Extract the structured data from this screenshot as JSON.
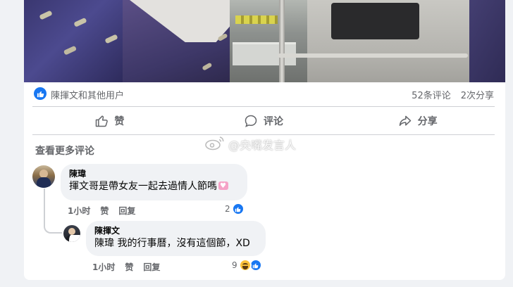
{
  "post": {
    "reactors_text": "陳揮文和其他用户",
    "comment_count": "52条评论",
    "share_count": "2次分享"
  },
  "actions": {
    "like_label": "赞",
    "comment_label": "评论",
    "share_label": "分享"
  },
  "more_comments_label": "查看更多评论",
  "watermark_text": "@央嘴发言人",
  "comments": [
    {
      "author": "陳瑋",
      "text": "揮文哥是帶女友一起去過情人節嗎",
      "time": "1小时",
      "like_label": "赞",
      "reply_label": "回复",
      "reaction_count": "2"
    },
    {
      "author": "陳揮文",
      "mention": "陳瑋",
      "text": " 我的行事曆，沒有這個節，XD",
      "time": "1小时",
      "like_label": "赞",
      "reply_label": "回复",
      "reaction_count": "9"
    }
  ],
  "colors": {
    "accent": "#1877f2",
    "muted_text": "#65676b",
    "bubble_bg": "#f0f2f5"
  },
  "icons": [
    "like-badge-icon",
    "thumbs-up-icon",
    "comment-icon",
    "share-icon",
    "weibo-icon",
    "haha-reaction-icon"
  ]
}
